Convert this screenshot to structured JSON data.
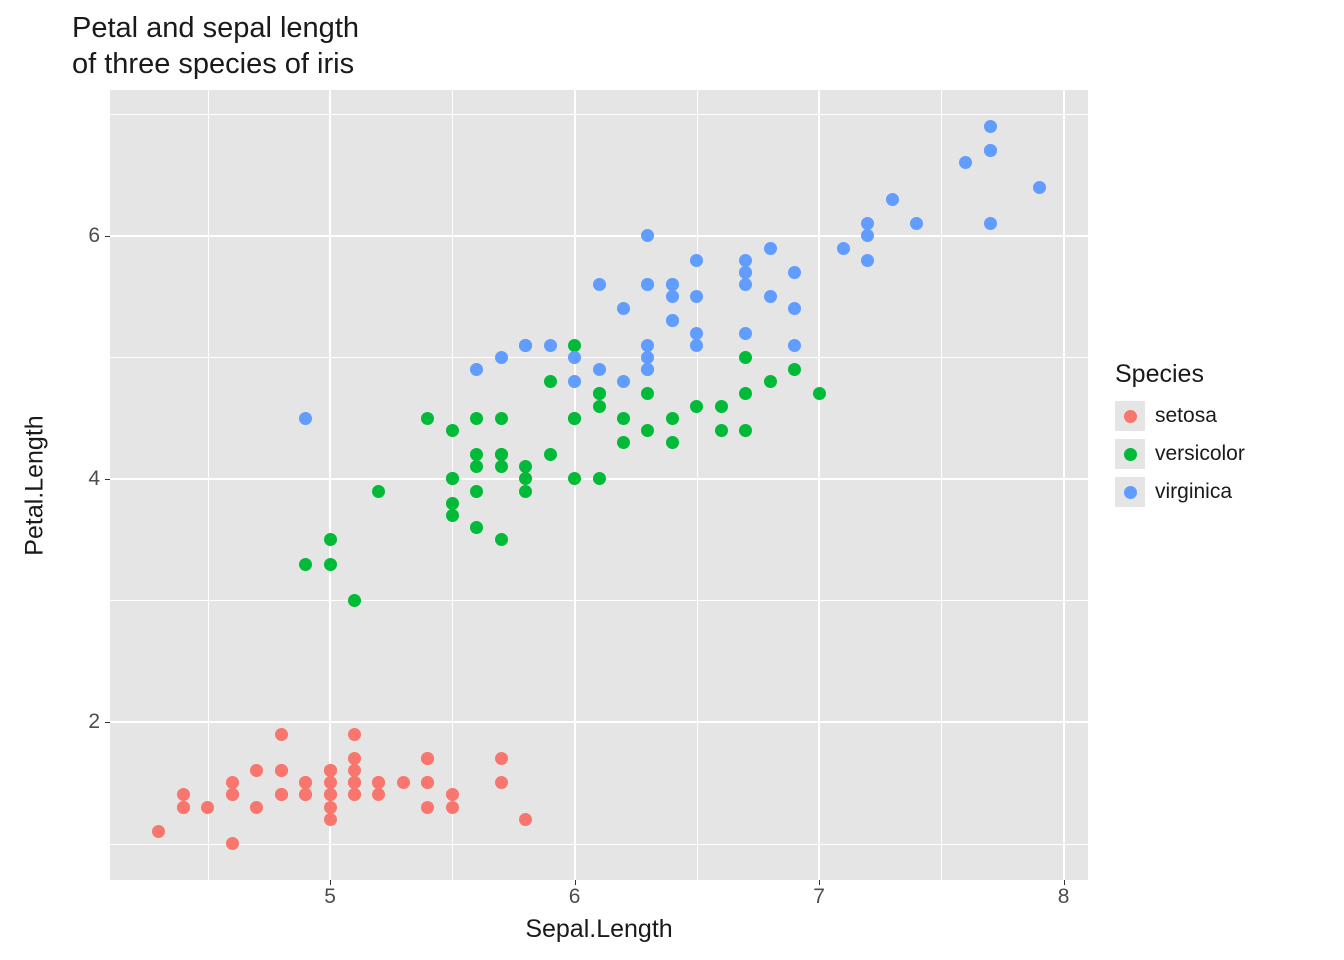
{
  "chart_data": {
    "type": "scatter",
    "title": "Petal and sepal length\nof three species of iris",
    "xlabel": "Sepal.Length",
    "ylabel": "Petal.Length",
    "xlim": [
      4.1,
      8.1
    ],
    "ylim": [
      0.7,
      7.2
    ],
    "x_ticks": [
      5,
      6,
      7,
      8
    ],
    "y_ticks": [
      2,
      4,
      6
    ],
    "x_minor": [
      4.5,
      5.5,
      6.5,
      7.5
    ],
    "y_minor": [
      1,
      3,
      5,
      7
    ],
    "legend_title": "Species",
    "series": [
      {
        "name": "setosa",
        "color": "#F8766D",
        "points": [
          [
            5.1,
            1.4
          ],
          [
            4.9,
            1.4
          ],
          [
            4.7,
            1.3
          ],
          [
            4.6,
            1.5
          ],
          [
            5.0,
            1.4
          ],
          [
            5.4,
            1.7
          ],
          [
            4.6,
            1.4
          ],
          [
            5.0,
            1.5
          ],
          [
            4.4,
            1.4
          ],
          [
            4.9,
            1.5
          ],
          [
            5.4,
            1.5
          ],
          [
            4.8,
            1.6
          ],
          [
            4.8,
            1.4
          ],
          [
            4.3,
            1.1
          ],
          [
            5.8,
            1.2
          ],
          [
            5.7,
            1.5
          ],
          [
            5.4,
            1.3
          ],
          [
            5.1,
            1.4
          ],
          [
            5.7,
            1.7
          ],
          [
            5.1,
            1.5
          ],
          [
            5.4,
            1.7
          ],
          [
            5.1,
            1.5
          ],
          [
            4.6,
            1.0
          ],
          [
            5.1,
            1.7
          ],
          [
            4.8,
            1.9
          ],
          [
            5.0,
            1.6
          ],
          [
            5.0,
            1.6
          ],
          [
            5.2,
            1.5
          ],
          [
            5.2,
            1.4
          ],
          [
            4.7,
            1.6
          ],
          [
            4.8,
            1.6
          ],
          [
            5.4,
            1.5
          ],
          [
            5.2,
            1.5
          ],
          [
            5.5,
            1.4
          ],
          [
            4.9,
            1.5
          ],
          [
            5.0,
            1.2
          ],
          [
            5.5,
            1.3
          ],
          [
            4.9,
            1.4
          ],
          [
            4.4,
            1.3
          ],
          [
            5.1,
            1.5
          ],
          [
            5.0,
            1.3
          ],
          [
            4.5,
            1.3
          ],
          [
            4.4,
            1.3
          ],
          [
            5.0,
            1.6
          ],
          [
            5.1,
            1.9
          ],
          [
            4.8,
            1.4
          ],
          [
            5.1,
            1.6
          ],
          [
            4.6,
            1.4
          ],
          [
            5.3,
            1.5
          ],
          [
            5.0,
            1.4
          ]
        ]
      },
      {
        "name": "versicolor",
        "color": "#00BA38",
        "points": [
          [
            7.0,
            4.7
          ],
          [
            6.4,
            4.5
          ],
          [
            6.9,
            4.9
          ],
          [
            5.5,
            4.0
          ],
          [
            6.5,
            4.6
          ],
          [
            5.7,
            4.5
          ],
          [
            6.3,
            4.7
          ],
          [
            4.9,
            3.3
          ],
          [
            6.6,
            4.6
          ],
          [
            5.2,
            3.9
          ],
          [
            5.0,
            3.5
          ],
          [
            5.9,
            4.2
          ],
          [
            6.0,
            4.0
          ],
          [
            6.1,
            4.7
          ],
          [
            5.6,
            3.6
          ],
          [
            6.7,
            4.4
          ],
          [
            5.6,
            4.5
          ],
          [
            5.8,
            4.1
          ],
          [
            6.2,
            4.5
          ],
          [
            5.6,
            3.9
          ],
          [
            5.9,
            4.8
          ],
          [
            6.1,
            4.0
          ],
          [
            6.3,
            4.9
          ],
          [
            6.1,
            4.7
          ],
          [
            6.4,
            4.3
          ],
          [
            6.6,
            4.4
          ],
          [
            6.8,
            4.8
          ],
          [
            6.7,
            5.0
          ],
          [
            6.0,
            4.5
          ],
          [
            5.7,
            3.5
          ],
          [
            5.5,
            3.8
          ],
          [
            5.5,
            3.7
          ],
          [
            5.8,
            3.9
          ],
          [
            6.0,
            5.1
          ],
          [
            5.4,
            4.5
          ],
          [
            6.0,
            4.5
          ],
          [
            6.7,
            4.7
          ],
          [
            6.3,
            4.4
          ],
          [
            5.6,
            4.1
          ],
          [
            5.5,
            4.0
          ],
          [
            5.5,
            4.4
          ],
          [
            6.1,
            4.6
          ],
          [
            5.8,
            4.0
          ],
          [
            5.0,
            3.3
          ],
          [
            5.6,
            4.2
          ],
          [
            5.7,
            4.2
          ],
          [
            5.7,
            4.2
          ],
          [
            6.2,
            4.3
          ],
          [
            5.1,
            3.0
          ],
          [
            5.7,
            4.1
          ]
        ]
      },
      {
        "name": "virginica",
        "color": "#619CFF",
        "points": [
          [
            6.3,
            6.0
          ],
          [
            5.8,
            5.1
          ],
          [
            7.1,
            5.9
          ],
          [
            6.3,
            5.6
          ],
          [
            6.5,
            5.8
          ],
          [
            7.6,
            6.6
          ],
          [
            4.9,
            4.5
          ],
          [
            7.3,
            6.3
          ],
          [
            6.7,
            5.8
          ],
          [
            7.2,
            6.1
          ],
          [
            6.5,
            5.1
          ],
          [
            6.4,
            5.3
          ],
          [
            6.8,
            5.5
          ],
          [
            5.7,
            5.0
          ],
          [
            5.8,
            5.1
          ],
          [
            6.4,
            5.3
          ],
          [
            6.5,
            5.5
          ],
          [
            7.7,
            6.7
          ],
          [
            7.7,
            6.9
          ],
          [
            6.0,
            5.0
          ],
          [
            6.9,
            5.7
          ],
          [
            5.6,
            4.9
          ],
          [
            7.7,
            6.7
          ],
          [
            6.3,
            4.9
          ],
          [
            6.7,
            5.7
          ],
          [
            7.2,
            6.0
          ],
          [
            6.2,
            4.8
          ],
          [
            6.1,
            4.9
          ],
          [
            6.4,
            5.6
          ],
          [
            7.2,
            5.8
          ],
          [
            7.4,
            6.1
          ],
          [
            7.9,
            6.4
          ],
          [
            6.4,
            5.6
          ],
          [
            6.3,
            5.1
          ],
          [
            6.1,
            5.6
          ],
          [
            7.7,
            6.1
          ],
          [
            6.3,
            5.6
          ],
          [
            6.4,
            5.5
          ],
          [
            6.0,
            4.8
          ],
          [
            6.9,
            5.4
          ],
          [
            6.7,
            5.6
          ],
          [
            6.9,
            5.1
          ],
          [
            5.8,
            5.1
          ],
          [
            6.8,
            5.9
          ],
          [
            6.7,
            5.7
          ],
          [
            6.7,
            5.2
          ],
          [
            6.3,
            5.0
          ],
          [
            6.5,
            5.2
          ],
          [
            6.2,
            5.4
          ],
          [
            5.9,
            5.1
          ]
        ]
      }
    ]
  }
}
